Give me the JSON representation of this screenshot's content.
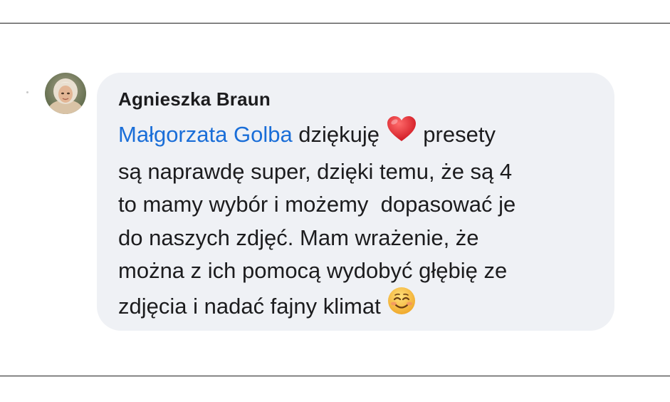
{
  "comment": {
    "author": "Agnieszka Braun",
    "mention": "Małgorzata Golba",
    "lines": [
      " dziękuję ",
      "presety",
      "są naprawdę super, dzięki temu, że są 4",
      "to mamy wybór i możemy  dopasować je",
      "do naszych zdjęć. Mam wrażenie, że",
      "można z ich pomocą wydobyć głębię ze",
      "zdjęcia i nadać fajny klimat "
    ],
    "emojis": [
      "red-heart",
      "smiling-face"
    ]
  },
  "colors": {
    "mention": "#1a6ed8",
    "bubble": "#eff1f5",
    "text": "#1c1c1e",
    "heart": "#e0242c",
    "smiley": "#f6c343"
  }
}
